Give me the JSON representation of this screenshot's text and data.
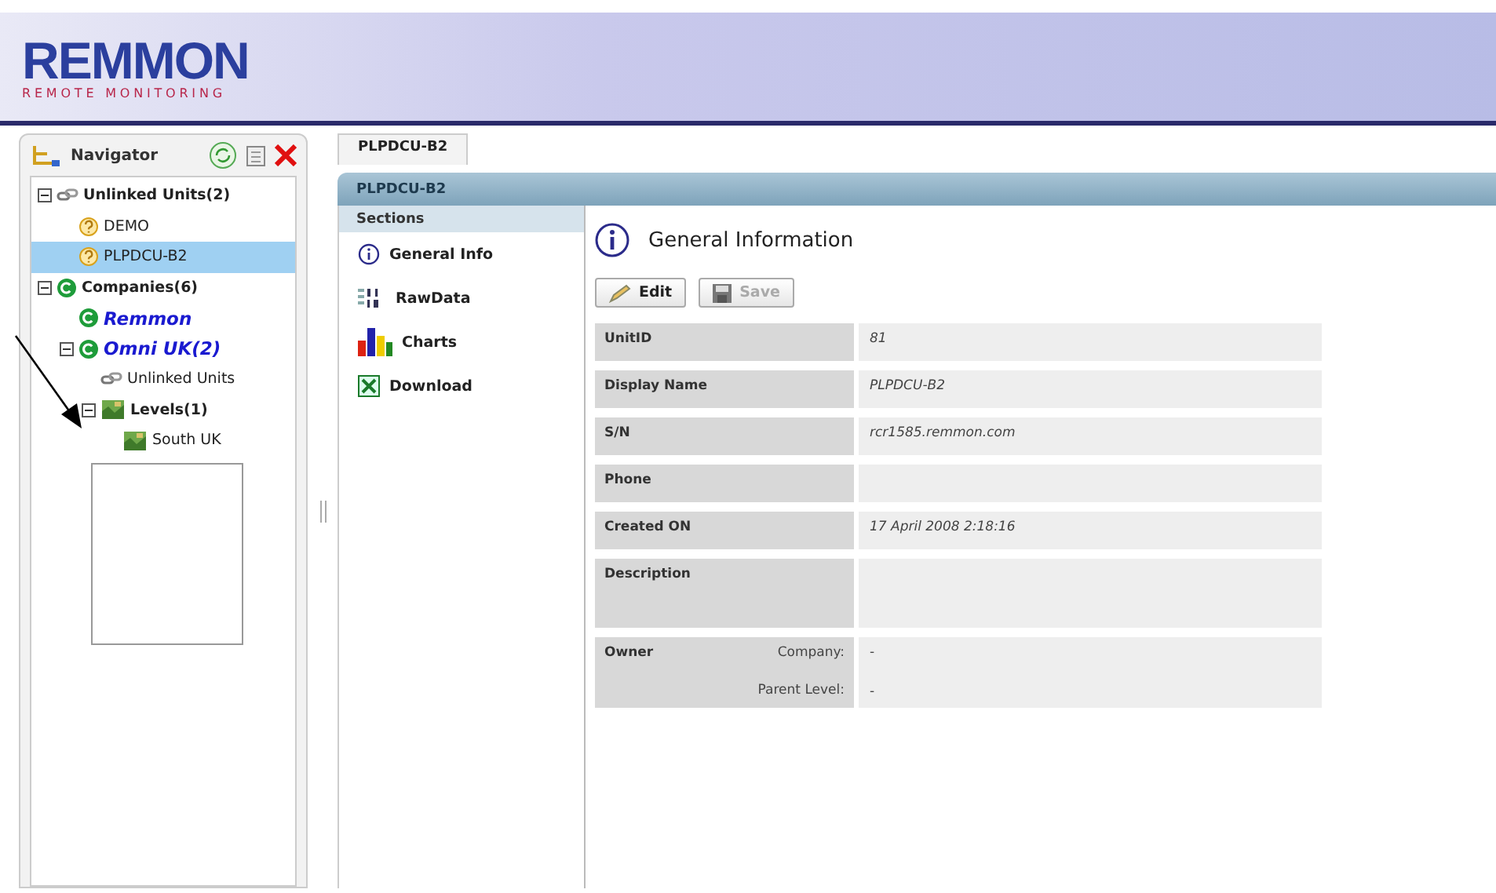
{
  "logo": {
    "name": "REMMON",
    "tagline": "REMOTE MONITORING"
  },
  "navigator": {
    "title": "Navigator",
    "tree": [
      {
        "label": "Unlinked Units(2)",
        "kind": "units",
        "expanded": true,
        "selected": false,
        "children": [
          {
            "label": "DEMO",
            "kind": "unit",
            "selected": false
          },
          {
            "label": "PLPDCU-B2",
            "kind": "unit",
            "selected": true
          }
        ]
      },
      {
        "label": "Companies(6)",
        "kind": "companies",
        "expanded": true,
        "selected": false,
        "children": [
          {
            "label": "Remmon",
            "kind": "company",
            "selected": false
          },
          {
            "label": "Omni UK(2)",
            "kind": "company",
            "expanded": true,
            "selected": false,
            "children": [
              {
                "label": "Unlinked Units",
                "kind": "links",
                "selected": false
              },
              {
                "label": "Levels(1)",
                "kind": "levels",
                "expanded": true,
                "selected": false,
                "children": [
                  {
                    "label": "South UK",
                    "kind": "level",
                    "selected": false
                  }
                ]
              }
            ]
          }
        ]
      }
    ]
  },
  "tabs": [
    {
      "label": "PLPDCU-B2",
      "selected": true
    }
  ],
  "panel": {
    "title": "PLPDCU-B2",
    "sections_title": "Sections",
    "sections": [
      {
        "label": "General Info",
        "kind": "info"
      },
      {
        "label": "RawData",
        "kind": "raw"
      },
      {
        "label": "Charts",
        "kind": "charts"
      },
      {
        "label": "Download",
        "kind": "excel"
      }
    ]
  },
  "details": {
    "title": "General Information",
    "buttons": [
      {
        "label": "Edit",
        "kind": "edit",
        "disabled": false
      },
      {
        "label": "Save",
        "kind": "save",
        "disabled": true
      }
    ],
    "fields": [
      {
        "label": "UnitID",
        "value": "81"
      },
      {
        "label": "Display Name",
        "value": "PLPDCU-B2"
      },
      {
        "label": "S/N",
        "value": "rcr1585.remmon.com"
      },
      {
        "label": "Phone"
      },
      {
        "label": "Created ON",
        "value": "17 April 2008 2:18:16"
      },
      {
        "label": "Description",
        "tall": true
      },
      {
        "label": "Owner",
        "subfields": [
          {
            "label": "Company:",
            "value": "-"
          },
          {
            "label": "Parent Level:",
            "value": "-"
          }
        ]
      }
    ]
  }
}
